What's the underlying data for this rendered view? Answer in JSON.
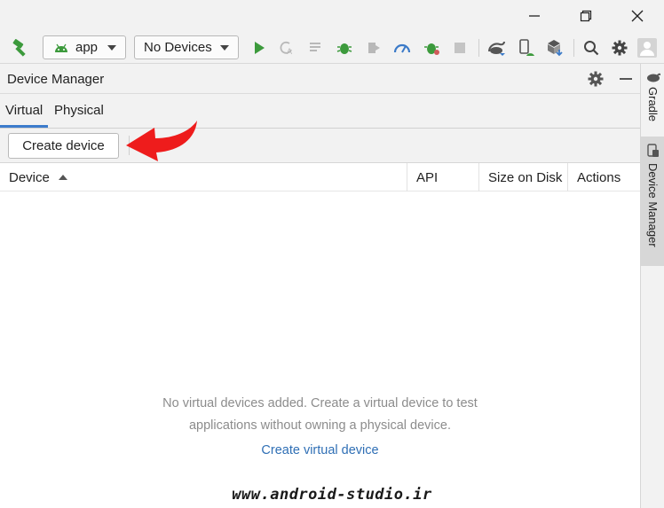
{
  "toolbar": {
    "run_config": "app",
    "device_selector": "No Devices"
  },
  "panel": {
    "title": "Device Manager",
    "tabs": [
      {
        "label": "Virtual"
      },
      {
        "label": "Physical"
      }
    ],
    "create_button": "Create device",
    "columns": {
      "device": "Device",
      "api": "API",
      "size": "Size on Disk",
      "actions": "Actions"
    },
    "empty_message_line1": "No virtual devices added. Create a virtual device to test",
    "empty_message_line2": "applications without owning a physical device.",
    "empty_link": "Create virtual device"
  },
  "right_strip": {
    "gradle_label": "Gradle",
    "device_manager_label": "Device Manager"
  },
  "watermark": "www.android-studio.ir",
  "colors": {
    "accent_blue": "#3d7ccc",
    "link_blue": "#2f6fb5",
    "run_green": "#3c9a3c",
    "callout_red": "#ee1c1c"
  }
}
